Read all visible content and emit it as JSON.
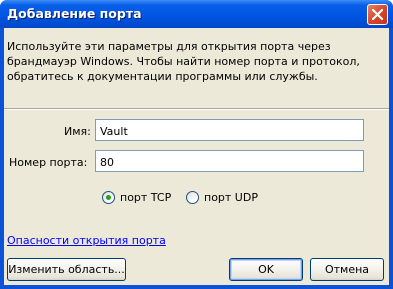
{
  "window": {
    "title": "Добавление порта"
  },
  "description": "Используйте эти параметры для открытия порта через брандмауэр Windows. Чтобы найти номер порта и протокол, обратитесь к документации программы или службы.",
  "form": {
    "name_label": "Имя:",
    "name_value": "Vault",
    "port_label": "Номер порта:",
    "port_value": "80"
  },
  "protocol": {
    "selected": "tcp",
    "tcp_label": "порт TCP",
    "udp_label": "порт UDP"
  },
  "link_text": "Опасности открытия порта",
  "buttons": {
    "change_scope": "Изменить область...",
    "ok": "OK",
    "cancel": "Отмена"
  },
  "icons": {
    "close": "close-icon",
    "radio_checked_color": "#21a121"
  },
  "colors": {
    "titlebar": "#0055e5",
    "dialog_bg": "#ece9d8",
    "close_button": "#d6482b",
    "link": "#0000ff"
  }
}
